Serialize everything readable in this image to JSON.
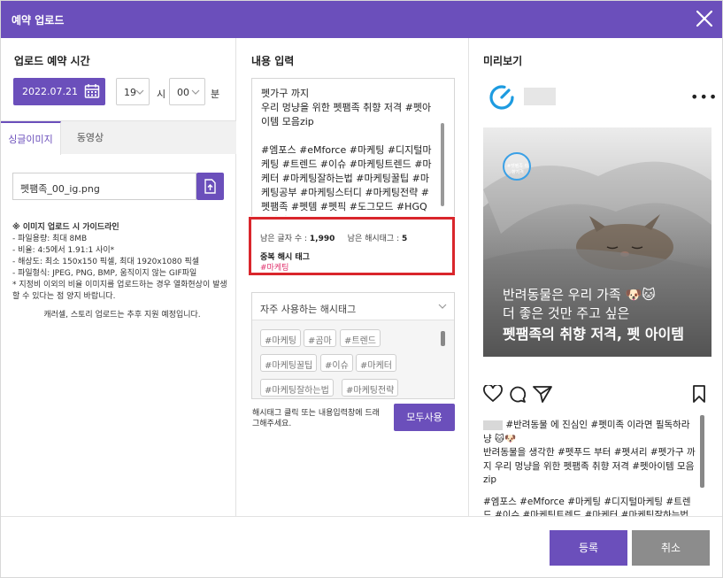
{
  "window": {
    "title": "예약 업로드"
  },
  "schedule": {
    "section_title": "업로드 예약 시간",
    "date": "2022.07.21",
    "hour": "19",
    "hour_unit": "시",
    "minute": "00",
    "minute_unit": "분"
  },
  "tabs": [
    {
      "label": "싱글이미지",
      "active": true
    },
    {
      "label": "동영상",
      "active": false
    }
  ],
  "file": {
    "name": "펫팸족_00_ig.png"
  },
  "guide": {
    "title": "※ 이미지 업로드 시 가이드라인",
    "lines": [
      "- 파일용량: 최대 8MB",
      "- 비율: 4:5에서 1.91:1 사이*",
      "- 해상도: 최소 150x150 픽셀, 최대 1920x1080 픽셀",
      "- 파일형식: JPEG, PNG, BMP, 움직이지 않는 GIF파일",
      "* 지정비 이외의 비율 이미지를 업로드하는 경우 열화현상이 발생할 수 있다는 점 양지 바랍니다."
    ],
    "note": "캐러셀, 스토리 업로드는 추후 지원 예정입니다."
  },
  "content": {
    "section_title": "내용 입력",
    "text": "펫가구 까지\n우리 멍냥을 위한 펫팸족 취향 저격 #펫아이템 모음zip\n\n#엠포스 #eMforce #마케팅 #디지털마케팅 #트렌드 #이슈 #마케팅트렌드 #마케터 #마케팅잘하는법 #마케팅꿀팁 #마케팅공부 #마케팅스터디 #마케팅전략 #펫팸족 #펫템 #펫픽 #도그모드 #HGQ #마케팅",
    "chars_label": "남은 글자 수 :",
    "chars_value": "1,990",
    "tags_label": "남은 해시태그 :",
    "tags_value": "5",
    "dup_title": "중복 해시 태그",
    "dup_value": "#마케팅"
  },
  "favorites": {
    "title": "자주 사용하는 해시태그",
    "tags": [
      "#마케팅",
      "#곰마",
      "#트렌드",
      "#마케팅꿀팁",
      "#이슈",
      "#마케터",
      "#마케팅잘하는법",
      "#마케팅전략"
    ],
    "hint": "해시태그 클릭 또는 내용입력창에 드래그해주세요.",
    "use_all": "모두사용"
  },
  "preview": {
    "section_title": "미리보기",
    "badge_text": "#펫팸족 취향저격",
    "caption1": "반려동물은 우리 가족 🐶🐱",
    "caption2": "더 좋은 것만 주고 싶은",
    "caption3": "펫팸족의 취향 저격, 펫 아이템",
    "feed_line1": "#반려동물 에 진심인 #펫미족 이라면 필독하라냥 🐱🐶",
    "feed_line2": "반려동물을 생각한 #펫푸드 부터 #펫셔리 #펫가구 까지 우리 멍냥을 위한 펫팸족 취향 저격 #펫아이템 모음zip",
    "feed_line3": "#엠포스 #eMforce #마케팅 #디지털마케팅 #트렌드 #이슈 #마케팅트렌드 #마케터 #마케팅잘하는법 #마케팅꿀팁 #마케팅공부 #마케팅스터디 #마케팅전략 #펫팸족"
  },
  "footer": {
    "register": "등록",
    "cancel": "취소"
  },
  "colors": {
    "accent": "#6b4fbb",
    "alert_border": "#d9262c",
    "dup_tag": "#e0306c",
    "cancel_bg": "#8c8c8c"
  }
}
